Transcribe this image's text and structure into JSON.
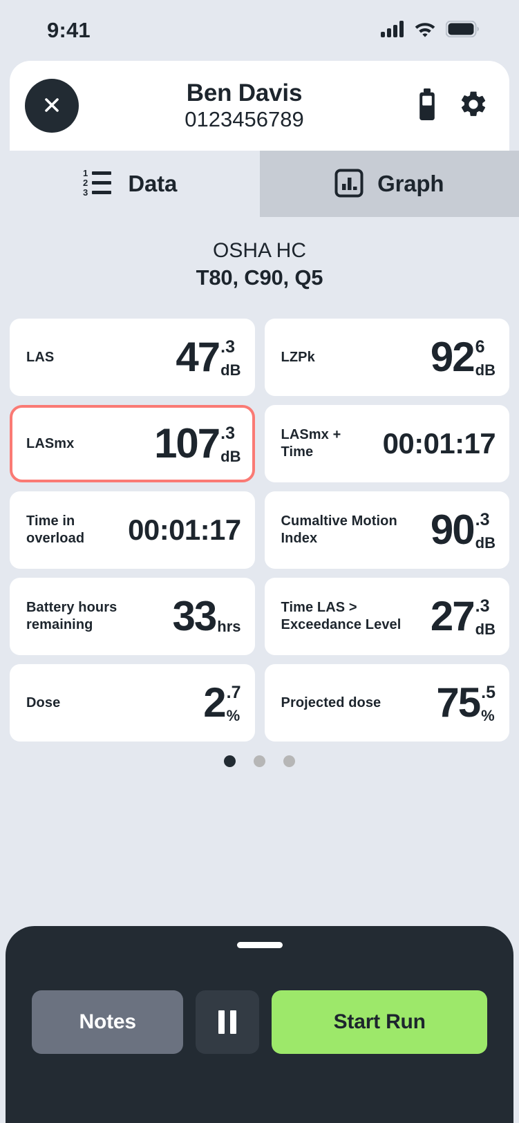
{
  "status_bar": {
    "time": "9:41",
    "cellular_icon": "cellular-signal-icon",
    "wifi_icon": "wifi-icon",
    "battery_icon": "battery-icon"
  },
  "header": {
    "close_icon": "close-icon",
    "name": "Ben Davis",
    "serial": "0123456789",
    "battery_icon": "device-battery-icon",
    "settings_icon": "gear-icon"
  },
  "tabs": [
    {
      "label": "Data",
      "icon": "numbered-list-icon",
      "active": false
    },
    {
      "label": "Graph",
      "icon": "bar-chart-icon",
      "active": true
    }
  ],
  "standard": {
    "name": "OSHA HC",
    "params": "T80, C90, Q5"
  },
  "metrics": [
    {
      "label": "LAS",
      "value": "47",
      "decimal": ".3",
      "unit": "dB",
      "layout": "stacked",
      "alert": false
    },
    {
      "label": "LZPk",
      "value": "92",
      "decimal": "6",
      "unit": "dB",
      "layout": "stacked",
      "alert": false
    },
    {
      "label": "LASmx",
      "value": "107",
      "decimal": ".3",
      "unit": "dB",
      "layout": "stacked",
      "alert": true
    },
    {
      "label": "LASmx + Time",
      "value": "00:01:17",
      "decimal": "",
      "unit": "",
      "layout": "time",
      "alert": false
    },
    {
      "label": "Time in overload",
      "value": "00:01:17",
      "decimal": "",
      "unit": "",
      "layout": "time",
      "alert": false
    },
    {
      "label": "Cumaltive Motion Index",
      "value": "90",
      "decimal": ".3",
      "unit": "dB",
      "layout": "stacked",
      "alert": false
    },
    {
      "label": "Battery hours remaining",
      "value": "33",
      "decimal": "",
      "unit": "hrs",
      "layout": "inline",
      "alert": false
    },
    {
      "label": "Time LAS > Exceedance Level",
      "value": "27",
      "decimal": ".3",
      "unit": "dB",
      "layout": "stacked",
      "alert": false
    },
    {
      "label": "Dose",
      "value": "2",
      "decimal": ".7",
      "unit": "%",
      "layout": "stacked",
      "alert": false
    },
    {
      "label": "Projected dose",
      "value": "75",
      "decimal": ".5",
      "unit": "%",
      "layout": "stacked",
      "alert": false
    }
  ],
  "pagination": {
    "total": 3,
    "active_index": 0
  },
  "bottom_bar": {
    "grabber": "drag-handle",
    "notes_label": "Notes",
    "pause_icon": "pause-icon",
    "start_label": "Start Run"
  },
  "colors": {
    "page_background": "#e4e8ef",
    "card_background": "#ffffff",
    "text_primary": "#1d252d",
    "alert_border": "#fa7a74",
    "active_tab_background": "#c7ccd4",
    "sheet_background": "#232b33",
    "start_button": "#9de86a",
    "notes_button": "#6b7280",
    "dot_active": "#222b33",
    "dot_inactive": "#b6b6b6"
  }
}
